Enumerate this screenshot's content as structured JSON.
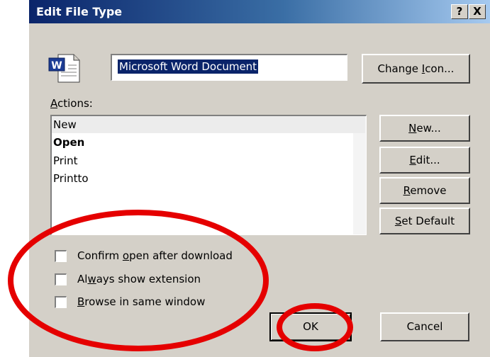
{
  "window": {
    "title": "Edit File Type",
    "help_label": "?",
    "close_label": "X"
  },
  "file_type": {
    "icon": "word-document-icon",
    "name_value": "Microsoft Word Document"
  },
  "buttons": {
    "change_icon_pre": "Change ",
    "change_icon_u": "I",
    "change_icon_post": "con...",
    "new_u": "N",
    "new_post": "ew...",
    "edit_u": "E",
    "edit_post": "dit...",
    "remove_u": "R",
    "remove_post": "emove",
    "set_default_u": "S",
    "set_default_post": "et Default",
    "ok": "OK",
    "cancel": "Cancel"
  },
  "actions": {
    "label_u": "A",
    "label_post": "ctions:",
    "items": [
      {
        "label": "New",
        "selected": true,
        "bold": false
      },
      {
        "label": "Open",
        "selected": false,
        "bold": true
      },
      {
        "label": "Print",
        "selected": false,
        "bold": false
      },
      {
        "label": "Printto",
        "selected": false,
        "bold": false
      }
    ]
  },
  "options": [
    {
      "pre": "Confirm ",
      "u": "o",
      "post": "pen after download",
      "checked": false
    },
    {
      "pre": "Al",
      "u": "w",
      "post": "ays show extension",
      "checked": false
    },
    {
      "pre": "",
      "u": "B",
      "post": "rowse in same window",
      "checked": false
    }
  ],
  "colors": {
    "title_gradient_start": "#0a246a",
    "dialog_face": "#d4d0c8",
    "annotation": "#e50000"
  }
}
